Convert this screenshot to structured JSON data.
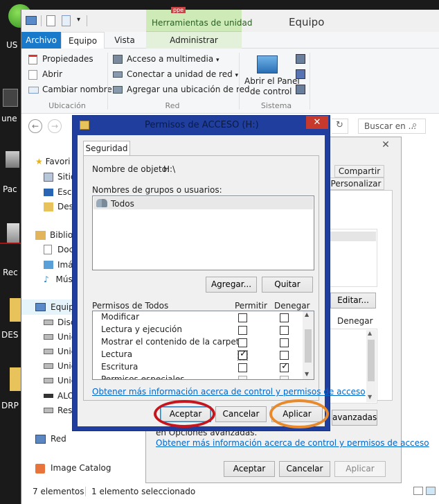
{
  "desktop": {
    "icons": [
      {
        "name": "us-icon",
        "label": "US"
      },
      {
        "name": "une-icon",
        "label": "une"
      },
      {
        "name": "pac-icon",
        "label": "Pac"
      },
      {
        "name": "rec-icon",
        "label": "Rec"
      },
      {
        "name": "des-icon",
        "label": "DES"
      },
      {
        "name": "drp-icon",
        "label": "DRP"
      }
    ],
    "partial_tab": "ppe"
  },
  "explorer": {
    "title": "Equipo",
    "contextual_tab": "Herramientas de unidad",
    "tabs": {
      "archivo": "Archivo",
      "equipo": "Equipo",
      "vista": "Vista",
      "administrar": "Administrar"
    },
    "ribbon": {
      "ubicacion": {
        "propiedades": "Propiedades",
        "abrir": "Abrir",
        "cambiar_nombre": "Cambiar nombre",
        "group": "Ubicación"
      },
      "red": {
        "acceso_multimedia": "Acceso a multimedia",
        "conectar_unidad": "Conectar a unidad de red",
        "agregar_ubicacion": "Agregar una ubicación de red",
        "group": "Red"
      },
      "sistema": {
        "abrir_panel_1": "Abrir el Panel",
        "abrir_panel_2": "de control",
        "group": "Sistema"
      }
    },
    "search_placeholder": "Buscar en ...",
    "nav": {
      "favoritos": "Favori",
      "sitios": "Sitio",
      "escritorio": "Escr",
      "descargas": "Desc",
      "bibliotecas": "Biblio",
      "documentos": "Doc",
      "imagenes": "Imá",
      "musica": "Mús",
      "equipo": "Equipo",
      "disco": "Disc",
      "unidad1": "Unic",
      "unidad2": "Unic",
      "unidad3": "Unic",
      "unidad4": "Unic",
      "alo": "ALO",
      "rese": "Rese",
      "red": "Red",
      "image_catalog": "Image Catalog"
    },
    "status": {
      "elementos": "7 elementos",
      "seleccionado": "1 elemento seleccionado"
    }
  },
  "props_dialog": {
    "compartir": "Compartir",
    "personalizar": "Personalizar",
    "editar": "Editar...",
    "denegar": "Denegar",
    "avanzadas": "avanzadas",
    "opciones_text": "en Opciones avanzadas.",
    "info_link": "Obtener más información acerca de control y permisos de acceso",
    "aceptar": "Aceptar",
    "cancelar": "Cancelar",
    "aplicar": "Aplicar"
  },
  "permissions_dialog": {
    "title": "Permisos de ACCESO (H:)",
    "tab": "Seguridad",
    "object_label": "Nombre de objeto:",
    "object_value": "H:\\",
    "groups_label": "Nombres de grupos o usuarios:",
    "groups": [
      "Todos"
    ],
    "agregar": "Agregar...",
    "quitar": "Quitar",
    "permisos_header": "Permisos de Todos",
    "permitir": "Permitir",
    "denegar": "Denegar",
    "permissions": [
      {
        "name": "Modificar",
        "allow": false,
        "deny": false
      },
      {
        "name": "Lectura y ejecución",
        "allow": false,
        "deny": false
      },
      {
        "name": "Mostrar el contenido de la carpeta",
        "allow": false,
        "deny": false
      },
      {
        "name": "Lectura",
        "allow": true,
        "deny": false
      },
      {
        "name": "Escritura",
        "allow": false,
        "deny": true
      },
      {
        "name": "Permisos especiales",
        "allow": false,
        "deny": false
      }
    ],
    "info_link": "Obtener más información acerca de control y permisos de acceso",
    "aceptar": "Aceptar",
    "cancelar": "Cancelar",
    "aplicar": "Aplicar"
  },
  "colors": {
    "dialog_frame": "#1f3e9e",
    "close_red": "#c7392c",
    "archivo_blue": "#1979ca",
    "contextual_green": "#cdeab7",
    "highlight_red": "#c4161c",
    "highlight_orange": "#e88a2c"
  }
}
